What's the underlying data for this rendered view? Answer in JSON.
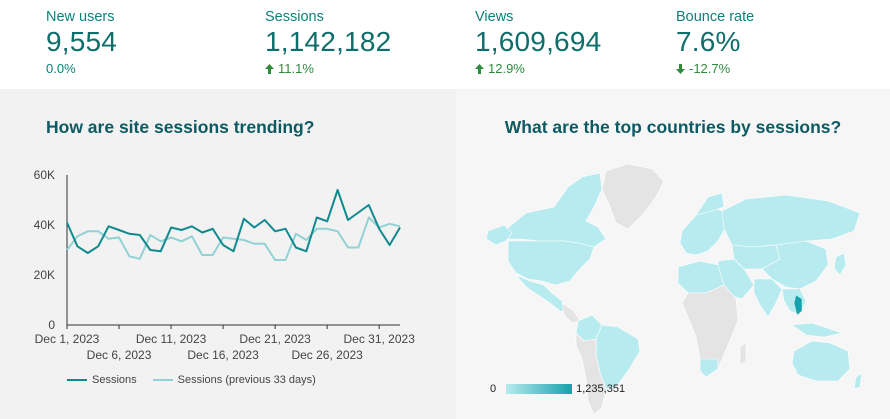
{
  "kpis": [
    {
      "label": "New users",
      "value": "9,554",
      "delta": "0.0%",
      "direction": "none"
    },
    {
      "label": "Sessions",
      "value": "1,142,182",
      "delta": "11.1%",
      "direction": "up"
    },
    {
      "label": "Views",
      "value": "1,609,694",
      "delta": "12.9%",
      "direction": "up"
    },
    {
      "label": "Bounce rate",
      "value": "7.6%",
      "delta": "-12.7%",
      "direction": "down"
    }
  ],
  "trend": {
    "title": "How are site sessions trending?",
    "legend": {
      "current": "Sessions",
      "previous": "Sessions (previous 33 days)"
    }
  },
  "map": {
    "title": "What are the top countries by sessions?",
    "scale_min": "0",
    "scale_max": "1,235,351"
  },
  "colors": {
    "current_series": "#0f8a8f",
    "previous_series": "#92d2d4",
    "text_dark": "#0e5a63",
    "good": "#2e8b3d",
    "map_high": "#16a1ac",
    "map_low": "#b8ebef",
    "map_none": "#e4e4e4"
  },
  "chart_data": {
    "type": "line",
    "title": "How are site sessions trending?",
    "x": [
      "Dec 1",
      "Dec 2",
      "Dec 3",
      "Dec 4",
      "Dec 5",
      "Dec 6",
      "Dec 7",
      "Dec 8",
      "Dec 9",
      "Dec 10",
      "Dec 11",
      "Dec 12",
      "Dec 13",
      "Dec 14",
      "Dec 15",
      "Dec 16",
      "Dec 17",
      "Dec 18",
      "Dec 19",
      "Dec 20",
      "Dec 21",
      "Dec 22",
      "Dec 23",
      "Dec 24",
      "Dec 25",
      "Dec 26",
      "Dec 27",
      "Dec 28",
      "Dec 29",
      "Dec 30",
      "Dec 31",
      "Jan 1",
      "Jan 2"
    ],
    "x_tick_labels": [
      "Dec 1, 2023",
      "Dec 6, 2023",
      "Dec 11, 2023",
      "Dec 16, 2023",
      "Dec 21, 2023",
      "Dec 26, 2023",
      "Dec 31, 2023"
    ],
    "x_tick_index": [
      0,
      5,
      10,
      15,
      20,
      25,
      30
    ],
    "y_ticks": [
      "0",
      "20K",
      "40K",
      "60K"
    ],
    "ylim": [
      0,
      60000
    ],
    "grid": false,
    "legend_position": "bottom-left",
    "series": [
      {
        "name": "Sessions",
        "values": [
          41000,
          31500,
          28800,
          31500,
          39500,
          38000,
          36500,
          36000,
          30000,
          29500,
          39000,
          38000,
          39500,
          37000,
          38500,
          32000,
          29500,
          42500,
          39000,
          42000,
          37500,
          38500,
          31000,
          29500,
          43000,
          41500,
          54000,
          42000,
          45000,
          48000,
          38500,
          32000,
          39000
        ]
      },
      {
        "name": "Sessions (previous 33 days)",
        "values": [
          30000,
          35500,
          37500,
          37500,
          34500,
          35000,
          27500,
          26500,
          36000,
          33500,
          35000,
          33500,
          35500,
          28000,
          28000,
          35000,
          34500,
          34000,
          32500,
          32500,
          26000,
          26000,
          36500,
          34000,
          38500,
          38500,
          37500,
          31000,
          31000,
          43000,
          39000,
          40500,
          39500
        ]
      }
    ]
  }
}
